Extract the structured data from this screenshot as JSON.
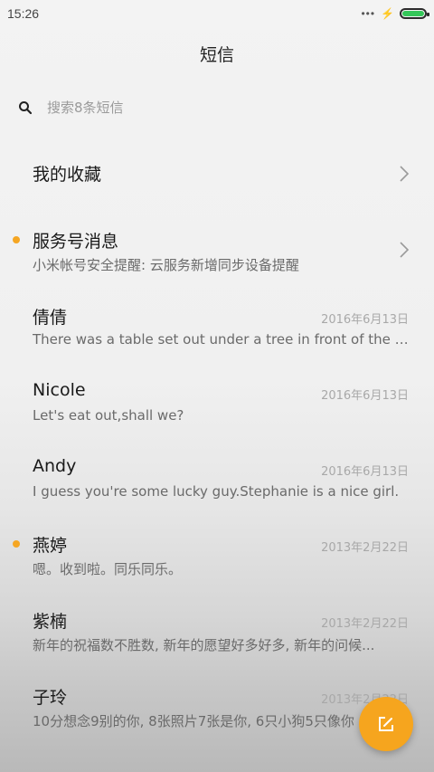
{
  "status_bar": {
    "time": "15:26",
    "dots": "•••",
    "charging": "⚡"
  },
  "header": {
    "title": "短信"
  },
  "search": {
    "placeholder": "搜索8条短信"
  },
  "list": [
    {
      "name": "我的收藏",
      "type": "folder"
    },
    {
      "name": "服务号消息",
      "preview": "小米帐号安全提醒: 云服务新增同步设备提醒",
      "unread": true,
      "type": "folder"
    },
    {
      "name": "倩倩",
      "date": "2016年6月13日",
      "preview": "There was a table set out under a tree in front of the ho...",
      "unread": false
    },
    {
      "name": "Nicole",
      "date": "2016年6月13日",
      "preview": "Let's eat out,shall we?",
      "unread": false
    },
    {
      "name": "Andy",
      "date": "2016年6月13日",
      "preview": "I guess you're some lucky guy.Stephanie is a nice girl.",
      "unread": false
    },
    {
      "name": "燕婷",
      "date": "2013年2月22日",
      "preview": "嗯。收到啦。同乐同乐。",
      "unread": true
    },
    {
      "name": "紫楠",
      "date": "2013年2月22日",
      "preview": "新年的祝福数不胜数, 新年的愿望好多好多, 新年的问候...",
      "unread": false
    },
    {
      "name": "子玲",
      "date": "2013年2月22日",
      "preview": "10分想念9别的你, 8张照片7张是你, 6只小狗5只像你",
      "unread": false
    }
  ],
  "colors": {
    "accent": "#f6a51e",
    "unread_dot": "#f5a623",
    "battery": "#34c759"
  },
  "icons": {
    "search": "search-icon",
    "chevron": "chevron-right-icon",
    "compose": "compose-icon"
  }
}
